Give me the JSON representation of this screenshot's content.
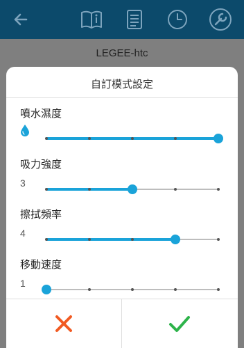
{
  "header": {
    "device_name": "LEGEE-htc",
    "icons": [
      "back-arrow-icon",
      "manual-book-icon",
      "list-icon",
      "clock-icon",
      "wrench-icon"
    ]
  },
  "dialog": {
    "title": "自訂模式設定",
    "settings": [
      {
        "label": "噴水濕度",
        "value_display": "",
        "icon": "water-drop-icon",
        "level": 5,
        "max": 5
      },
      {
        "label": "吸力強度",
        "value_display": "3",
        "level": 3,
        "max": 5
      },
      {
        "label": "擦拭頻率",
        "value_display": "4",
        "level": 4,
        "max": 5
      },
      {
        "label": "移動速度",
        "value_display": "1",
        "level": 1,
        "max": 5
      }
    ],
    "buttons": {
      "cancel": "cancel-x-icon",
      "confirm": "confirm-check-icon"
    }
  },
  "colors": {
    "accent": "#1aa3d9",
    "cancel": "#f15a22",
    "confirm": "#2db34a",
    "header": "#0c4a6b"
  }
}
